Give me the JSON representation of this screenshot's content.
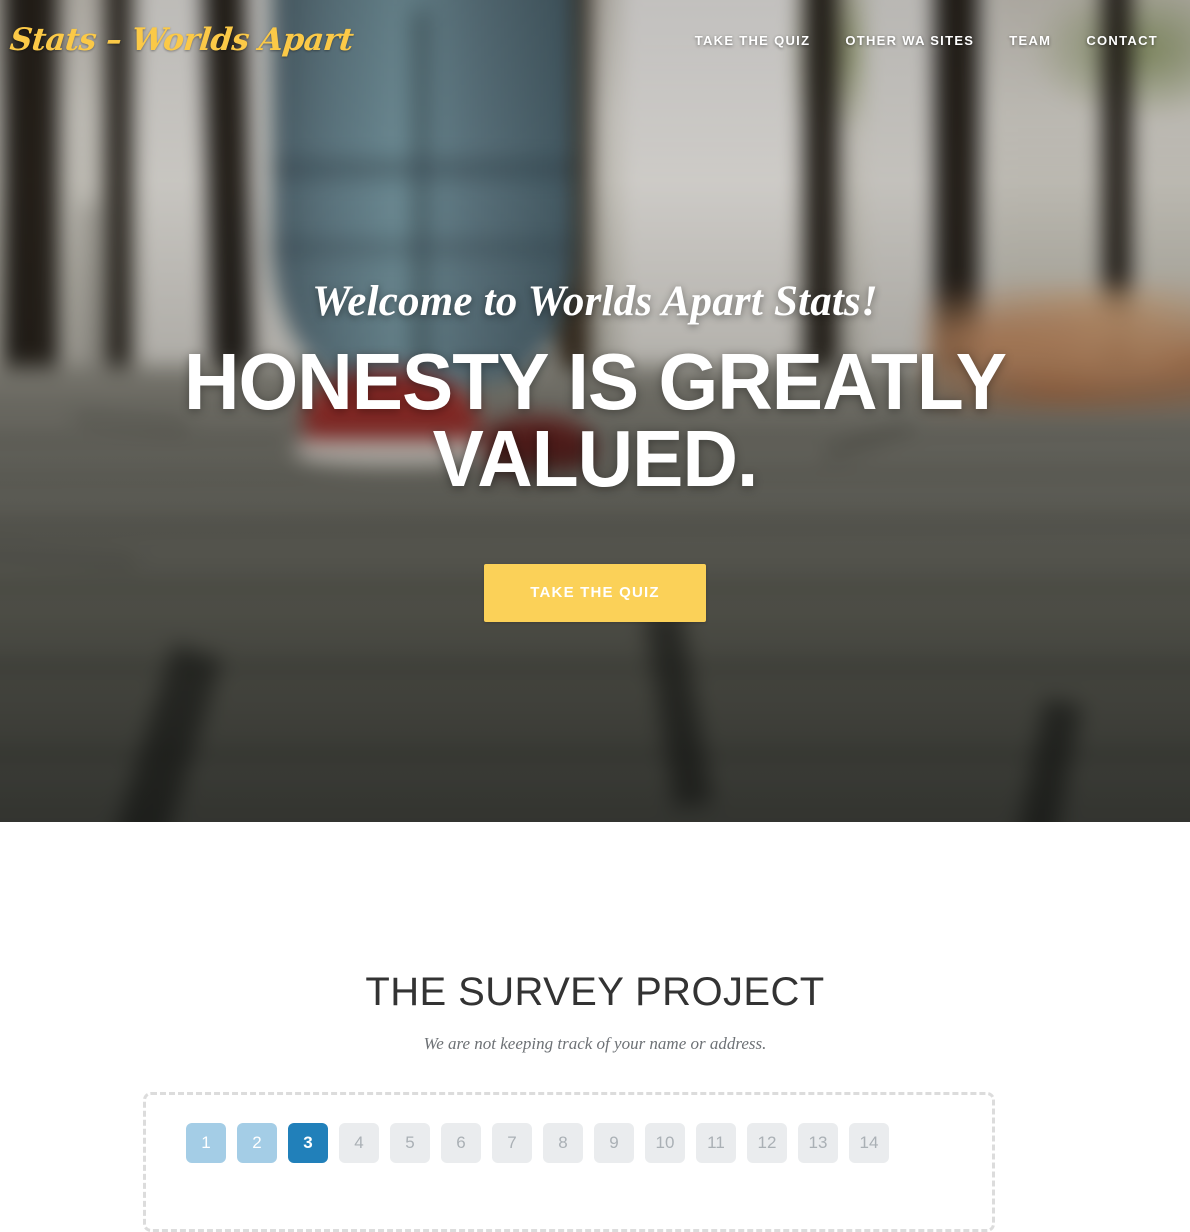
{
  "header": {
    "brand": "Stats – Worlds Apart",
    "brand_color": "#FBC947",
    "nav": [
      {
        "label": "TAKE THE QUIZ",
        "name": "nav-take-the-quiz"
      },
      {
        "label": "OTHER WA SITES",
        "name": "nav-other-wa-sites"
      },
      {
        "label": "TEAM",
        "name": "nav-team"
      },
      {
        "label": "CONTACT",
        "name": "nav-contact"
      }
    ]
  },
  "hero": {
    "kicker": "Welcome to Worlds Apart Stats!",
    "title": "HONESTY IS GREATLY VALUED.",
    "cta_label": "TAKE THE QUIZ",
    "cta_color": "#FBD158",
    "background_description": "blurred photo of a person in jeans and red sneakers walking on a grey wooden boardwalk between dark tree trunks with autumn leaves"
  },
  "survey": {
    "title": "THE SURVEY PROJECT",
    "subtitle": "We are not keeping track of your name or address.",
    "title_color": "#333333",
    "subtitle_color": "#6d7175",
    "current_step": 3,
    "total_steps": 14,
    "colors": {
      "completed": "#A4CDE6",
      "active": "#2180BA",
      "upcoming_bg": "#EAECEE",
      "upcoming_text": "#AAB0B5",
      "panel_border": "#dcdcdc"
    },
    "steps": [
      {
        "label": "1",
        "state": "done"
      },
      {
        "label": "2",
        "state": "done"
      },
      {
        "label": "3",
        "state": "active"
      },
      {
        "label": "4",
        "state": "todo"
      },
      {
        "label": "5",
        "state": "todo"
      },
      {
        "label": "6",
        "state": "todo"
      },
      {
        "label": "7",
        "state": "todo"
      },
      {
        "label": "8",
        "state": "todo"
      },
      {
        "label": "9",
        "state": "todo"
      },
      {
        "label": "10",
        "state": "todo"
      },
      {
        "label": "11",
        "state": "todo"
      },
      {
        "label": "12",
        "state": "todo"
      },
      {
        "label": "13",
        "state": "todo"
      },
      {
        "label": "14",
        "state": "todo"
      }
    ]
  }
}
